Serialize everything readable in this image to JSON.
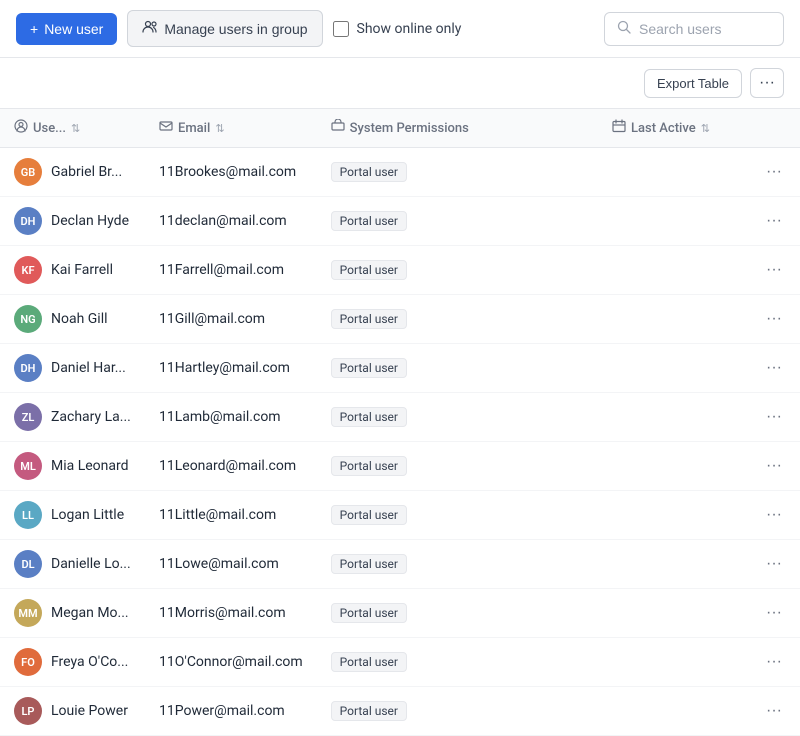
{
  "toolbar": {
    "new_user_label": "New user",
    "manage_group_label": "Manage users in group",
    "show_online_label": "Show online only",
    "search_placeholder": "Search users"
  },
  "actions_bar": {
    "export_label": "Export Table",
    "more_label": "···"
  },
  "table": {
    "columns": {
      "user": "Use...",
      "email": "Email",
      "permissions": "System Permissions",
      "last_active": "Last Active"
    },
    "rows": [
      {
        "id": 1,
        "initials": "GB",
        "color": "#e67e3c",
        "name": "Gabriel Br...",
        "email": "11Brookes@mail.com",
        "permission": "Portal user"
      },
      {
        "id": 2,
        "initials": "DH",
        "color": "#5a7fc4",
        "name": "Declan Hyde",
        "email": "11declan@mail.com",
        "permission": "Portal user"
      },
      {
        "id": 3,
        "initials": "KF",
        "color": "#e05a5a",
        "name": "Kai Farrell",
        "email": "11Farrell@mail.com",
        "permission": "Portal user"
      },
      {
        "id": 4,
        "initials": "NG",
        "color": "#5baa7a",
        "name": "Noah Gill",
        "email": "11Gill@mail.com",
        "permission": "Portal user"
      },
      {
        "id": 5,
        "initials": "DH",
        "color": "#5a7fc4",
        "name": "Daniel Har...",
        "email": "11Hartley@mail.com",
        "permission": "Portal user"
      },
      {
        "id": 6,
        "initials": "ZL",
        "color": "#7b6fa8",
        "name": "Zachary La...",
        "email": "11Lamb@mail.com",
        "permission": "Portal user"
      },
      {
        "id": 7,
        "initials": "ML",
        "color": "#c45a7f",
        "name": "Mia Leonard",
        "email": "11Leonard@mail.com",
        "permission": "Portal user"
      },
      {
        "id": 8,
        "initials": "LL",
        "color": "#5aa8c4",
        "name": "Logan Little",
        "email": "11Little@mail.com",
        "permission": "Portal user"
      },
      {
        "id": 9,
        "initials": "DL",
        "color": "#5a7fc4",
        "name": "Danielle Lo...",
        "email": "11Lowe@mail.com",
        "permission": "Portal user"
      },
      {
        "id": 10,
        "initials": "MM",
        "color": "#c4a85a",
        "name": "Megan Mo...",
        "email": "11Morris@mail.com",
        "permission": "Portal user"
      },
      {
        "id": 11,
        "initials": "FO",
        "color": "#e06b3c",
        "name": "Freya O'Co...",
        "email": "11O'Connor@mail.com",
        "permission": "Portal user"
      },
      {
        "id": 12,
        "initials": "LP",
        "color": "#a85a5a",
        "name": "Louie Power",
        "email": "11Power@mail.com",
        "permission": "Portal user"
      }
    ]
  },
  "icons": {
    "plus": "+",
    "user_group": "👥",
    "search": "🔍",
    "sort_both": "⇅",
    "calendar": "📅",
    "user_circle": "👤"
  }
}
